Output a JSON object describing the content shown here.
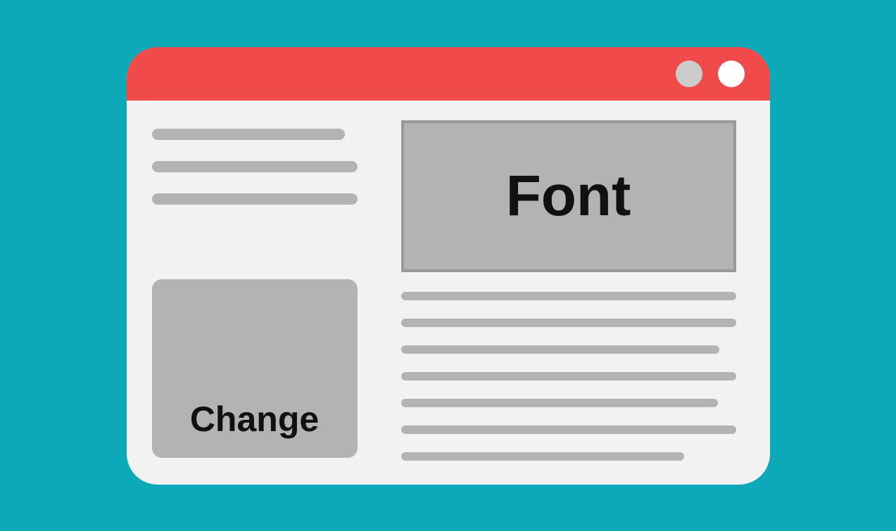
{
  "window": {
    "hero_label": "Font",
    "left_box_label": "Change"
  }
}
